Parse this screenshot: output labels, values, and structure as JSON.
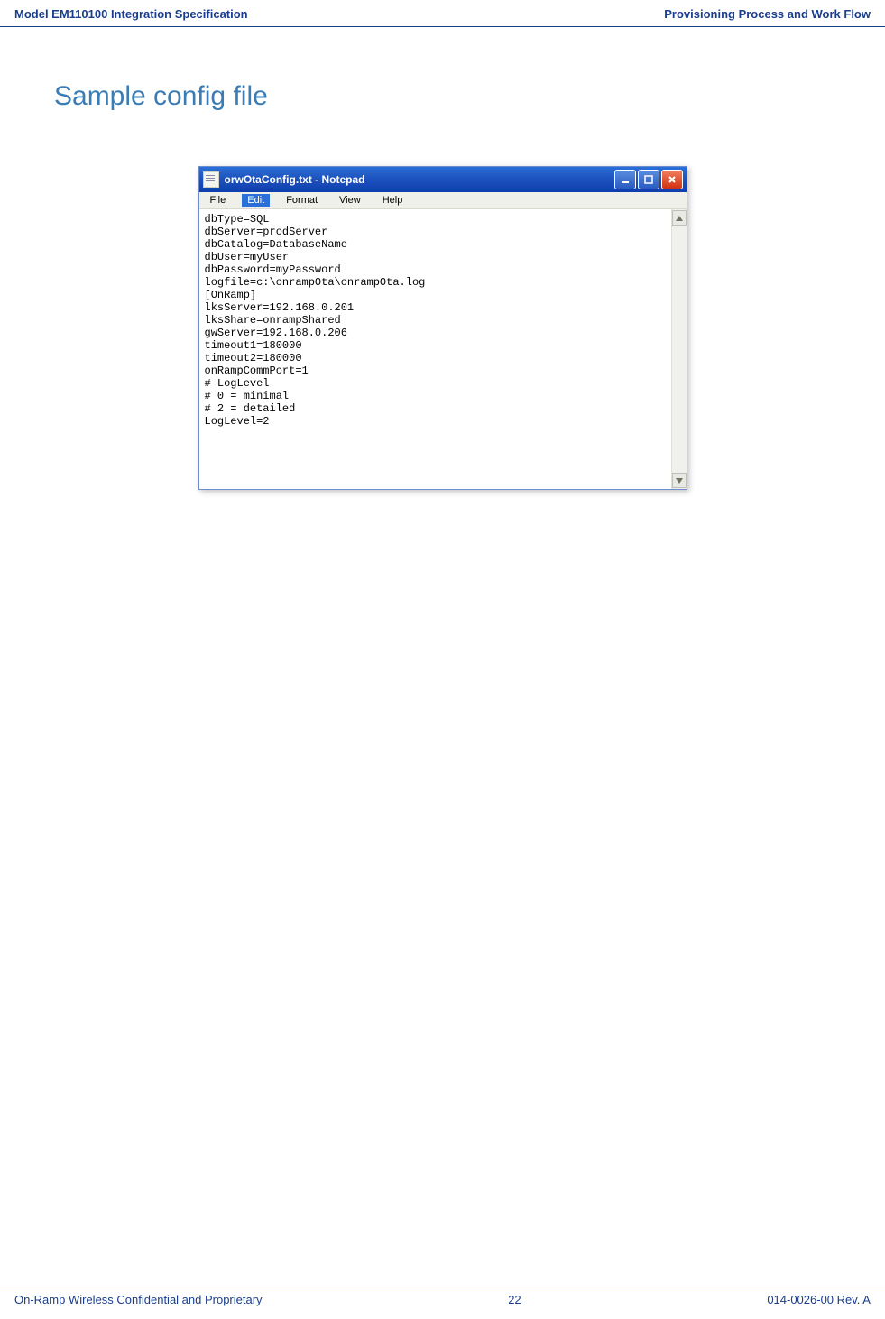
{
  "header": {
    "left": "Model EM110100 Integration Specification",
    "right": "Provisioning Process and Work Flow"
  },
  "section_title": "Sample config file",
  "notepad": {
    "title": "orwOtaConfig.txt - Notepad",
    "menus": {
      "file": "File",
      "edit": "Edit",
      "format": "Format",
      "view": "View",
      "help": "Help"
    },
    "content": "dbType=SQL\ndbServer=prodServer\ndbCatalog=DatabaseName\ndbUser=myUser\ndbPassword=myPassword\nlogfile=c:\\onrampOta\\onrampOta.log\n[OnRamp]\nlksServer=192.168.0.201\nlksShare=onrampShared\ngwServer=192.168.0.206\ntimeout1=180000\ntimeout2=180000\nonRampCommPort=1\n# LogLevel\n# 0 = minimal\n# 2 = detailed\nLogLevel=2"
  },
  "footer": {
    "left": "On-Ramp Wireless Confidential and Proprietary",
    "center": "22",
    "right": "014-0026-00 Rev. A"
  }
}
